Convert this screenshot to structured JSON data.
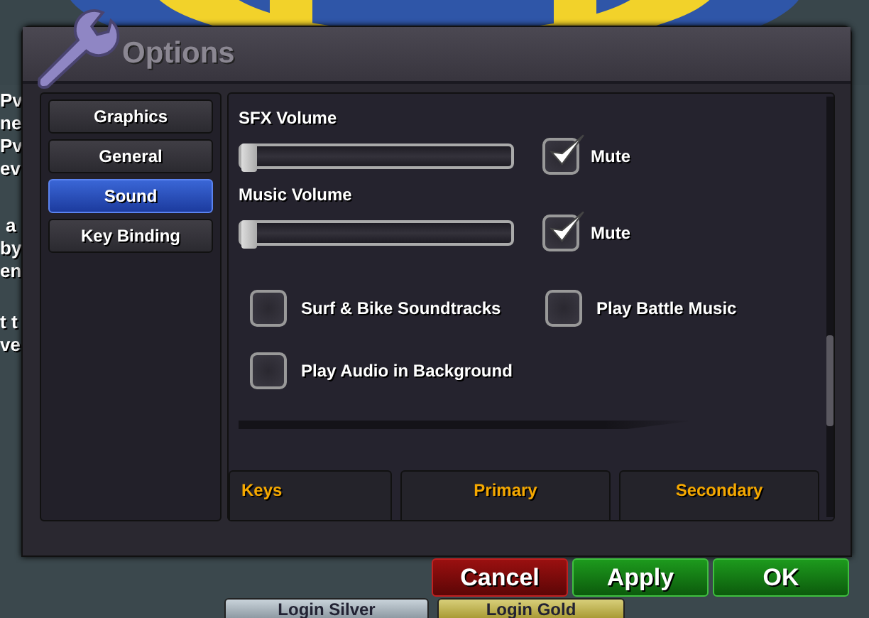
{
  "background": {
    "side_texts": [
      "Pv",
      "ne",
      "Pv",
      "ev",
      "a",
      "by",
      "en",
      "t t",
      "ve"
    ],
    "buttons": [
      {
        "label": "Login Silver",
        "kind": "silver"
      },
      {
        "label": "Login Gold",
        "kind": "gold"
      }
    ]
  },
  "window": {
    "title": "Options"
  },
  "sidebar": {
    "items": [
      {
        "label": "Graphics",
        "selected": false
      },
      {
        "label": "General",
        "selected": false
      },
      {
        "label": "Sound",
        "selected": true
      },
      {
        "label": "Key Binding",
        "selected": false
      }
    ]
  },
  "sliders": [
    {
      "label": "SFX Volume",
      "level": 0,
      "mute": {
        "label": "Mute",
        "checked": true
      }
    },
    {
      "label": "Music Volume",
      "level": 0,
      "mute": {
        "label": "Mute",
        "checked": true
      }
    }
  ],
  "options": [
    {
      "label": "Surf & Bike Soundtracks",
      "checked": false
    },
    {
      "label": "Play Battle Music",
      "checked": false
    },
    {
      "label": "Play Audio in Background",
      "checked": false
    }
  ],
  "table": {
    "columns": [
      "Keys",
      "Primary",
      "Secondary"
    ]
  },
  "buttons": [
    {
      "label": "Cancel",
      "kind": "cancel"
    },
    {
      "label": "Apply",
      "kind": "confirm"
    },
    {
      "label": "OK",
      "kind": "confirm"
    }
  ]
}
